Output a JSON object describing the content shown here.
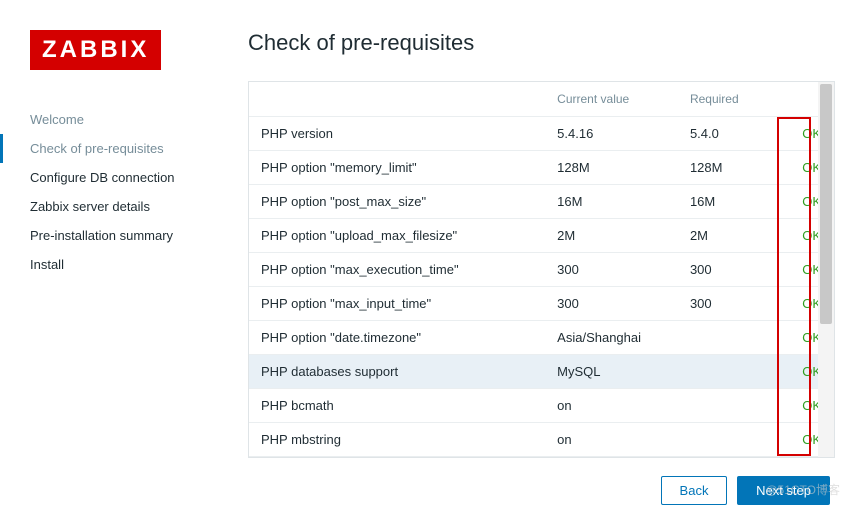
{
  "logo": "ZABBIX",
  "sidebar": {
    "items": [
      {
        "label": "Welcome",
        "active": false,
        "completed": true
      },
      {
        "label": "Check of pre-requisites",
        "active": true,
        "completed": false
      },
      {
        "label": "Configure DB connection",
        "active": false,
        "completed": false
      },
      {
        "label": "Zabbix server details",
        "active": false,
        "completed": false
      },
      {
        "label": "Pre-installation summary",
        "active": false,
        "completed": false
      },
      {
        "label": "Install",
        "active": false,
        "completed": false
      }
    ]
  },
  "page": {
    "title": "Check of pre-requisites"
  },
  "table": {
    "headers": {
      "name": "",
      "current": "Current value",
      "required": "Required",
      "status": ""
    },
    "rows": [
      {
        "name": "PHP version",
        "current": "5.4.16",
        "required": "5.4.0",
        "status": "OK",
        "highlight": false
      },
      {
        "name": "PHP option \"memory_limit\"",
        "current": "128M",
        "required": "128M",
        "status": "OK",
        "highlight": false
      },
      {
        "name": "PHP option \"post_max_size\"",
        "current": "16M",
        "required": "16M",
        "status": "OK",
        "highlight": false
      },
      {
        "name": "PHP option \"upload_max_filesize\"",
        "current": "2M",
        "required": "2M",
        "status": "OK",
        "highlight": false
      },
      {
        "name": "PHP option \"max_execution_time\"",
        "current": "300",
        "required": "300",
        "status": "OK",
        "highlight": false
      },
      {
        "name": "PHP option \"max_input_time\"",
        "current": "300",
        "required": "300",
        "status": "OK",
        "highlight": false
      },
      {
        "name": "PHP option \"date.timezone\"",
        "current": "Asia/Shanghai",
        "required": "",
        "status": "OK",
        "highlight": false
      },
      {
        "name": "PHP databases support",
        "current": "MySQL",
        "required": "",
        "status": "OK",
        "highlight": true
      },
      {
        "name": "PHP bcmath",
        "current": "on",
        "required": "",
        "status": "OK",
        "highlight": false
      },
      {
        "name": "PHP mbstring",
        "current": "on",
        "required": "",
        "status": "OK",
        "highlight": false
      }
    ]
  },
  "buttons": {
    "back": "Back",
    "next": "Next step"
  },
  "watermark": "@51CTO博客"
}
